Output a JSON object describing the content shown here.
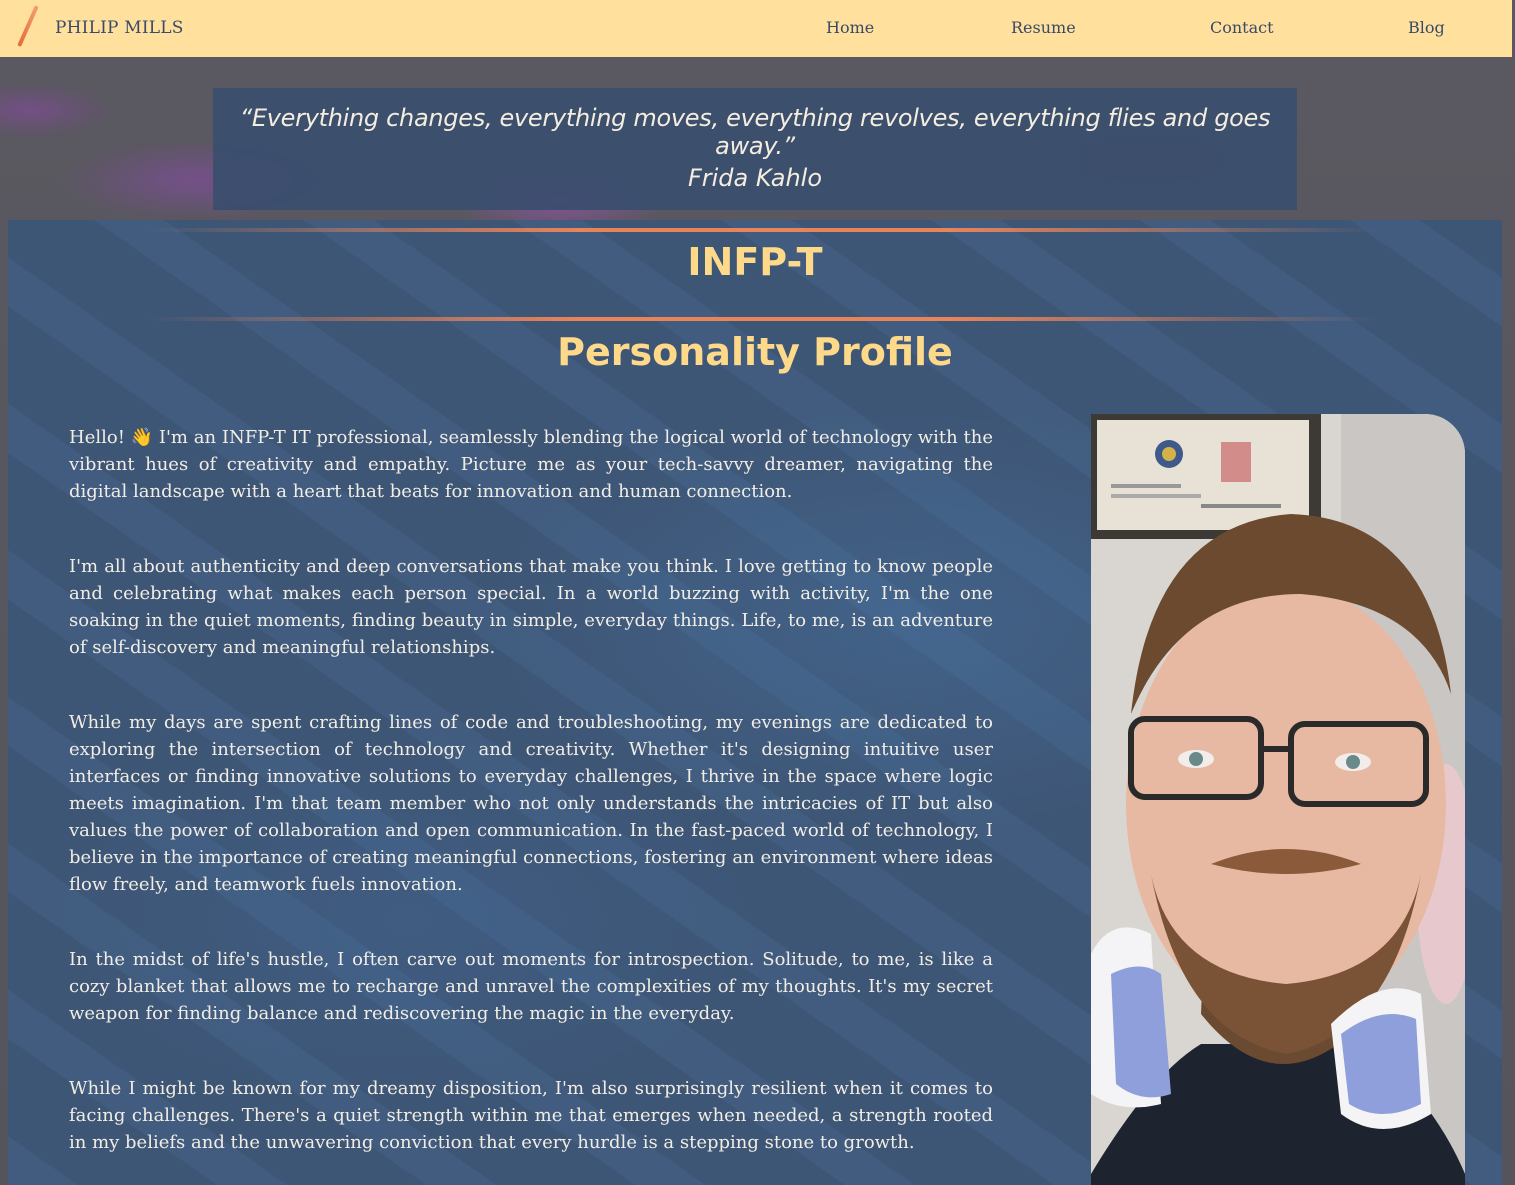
{
  "nav": {
    "brand": "PHILIP MILLS",
    "links": [
      "Home",
      "Resume",
      "Contact",
      "Blog"
    ]
  },
  "quote": {
    "text": "“Everything changes, everything moves, everything revolves, everything flies and goes away.”",
    "author": "Frida Kahlo"
  },
  "profile": {
    "type": "INFP-T",
    "heading": "Personality Profile",
    "paragraphs": [
      "Hello! 👋 I'm an INFP-T IT professional, seamlessly blending the logical world of technology with the vibrant hues of creativity and empathy. Picture me as your tech-savvy dreamer, navigating the digital landscape with a heart that beats for innovation and human connection.",
      "I'm all about authenticity and deep conversations that make you think. I love getting to know people and celebrating what makes each person special. In a world buzzing with activity, I'm the one soaking in the quiet moments, finding beauty in simple, everyday things. Life, to me, is an adventure of self-discovery and meaningful relationships.",
      "While my days are spent crafting lines of code and troubleshooting, my evenings are dedicated to exploring the intersection of technology and creativity. Whether it's designing intuitive user interfaces or finding innovative solutions to everyday challenges, I thrive in the space where logic meets imagination. I'm that team member who not only understands the intricacies of IT but also values the power of collaboration and open communication. In the fast-paced world of technology, I believe in the importance of creating meaningful connections, fostering an environment where ideas flow freely, and teamwork fuels innovation.",
      "In the midst of life's hustle, I often carve out moments for introspection. Solitude, to me, is like a cozy blanket that allows me to recharge and unravel the complexities of my thoughts. It's my secret weapon for finding balance and rediscovering the magic in the everyday.",
      "While I might be known for my dreamy disposition, I'm also surprisingly resilient when it comes to facing challenges. There's a quiet strength within me that emerges when needed, a strength rooted in my beliefs and the unwavering conviction that every hurdle is a stepping stone to growth."
    ]
  },
  "colors": {
    "nav_bg": "#ffe09c",
    "nav_text": "#3a4a6a",
    "panel_bg": "#3e5676",
    "accent_title": "#ffd98a",
    "divider": "#e8845a"
  }
}
